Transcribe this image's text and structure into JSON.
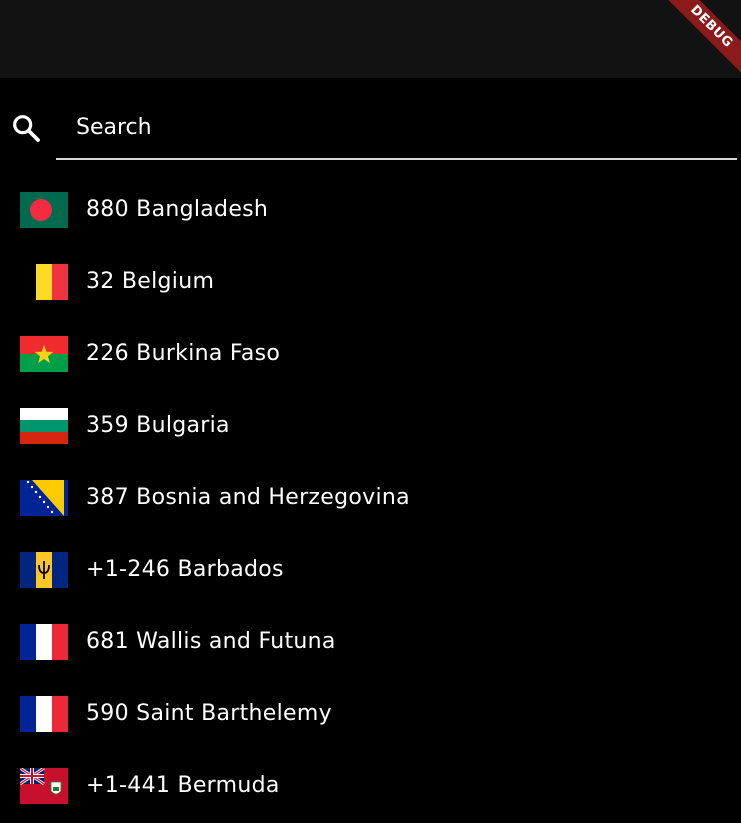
{
  "app_bar": {
    "debug_label": "DEBUG"
  },
  "search": {
    "placeholder": "Search",
    "value": "",
    "icon": "search-icon"
  },
  "countries": [
    {
      "label": "880 Bangladesh",
      "flag": "bangladesh-flag-icon"
    },
    {
      "label": "32 Belgium",
      "flag": "belgium-flag-icon"
    },
    {
      "label": "226 Burkina Faso",
      "flag": "burkina-faso-flag-icon"
    },
    {
      "label": "359 Bulgaria",
      "flag": "bulgaria-flag-icon"
    },
    {
      "label": "387 Bosnia and Herzegovina",
      "flag": "bosnia-herzegovina-flag-icon"
    },
    {
      "label": "+1-246 Barbados",
      "flag": "barbados-flag-icon"
    },
    {
      "label": "681 Wallis and Futuna",
      "flag": "wallis-futuna-flag-icon"
    },
    {
      "label": "590 Saint Barthelemy",
      "flag": "saint-barthelemy-flag-icon"
    },
    {
      "label": "+1-441 Bermuda",
      "flag": "bermuda-flag-icon"
    }
  ],
  "colors": {
    "background": "#000000",
    "app_bar": "#121212",
    "debug_banner": "#8b1a1a",
    "underline": "#d8d8d8"
  }
}
